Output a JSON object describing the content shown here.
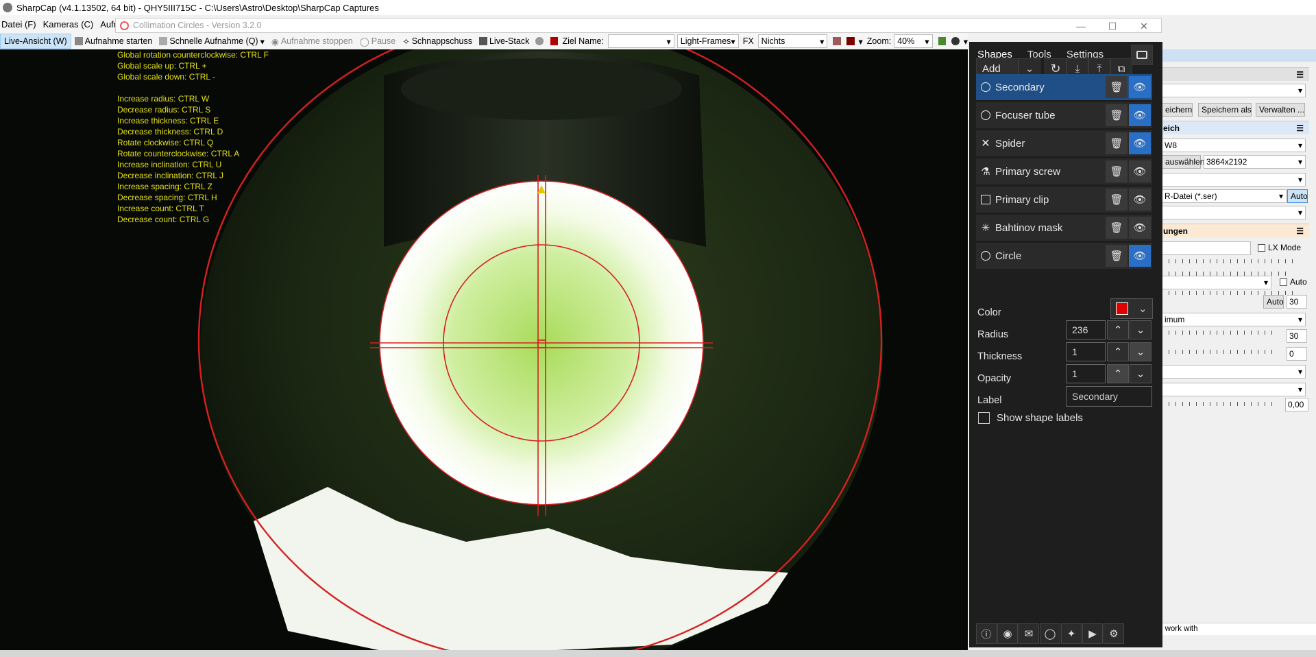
{
  "window": {
    "title": "SharpCap (v4.1.13502, 64 bit) - QHY5III715C - C:\\Users\\Astro\\Desktop\\SharpCap Captures"
  },
  "menu": [
    "Datei (F)",
    "Kameras (C)",
    "Aufna"
  ],
  "popup": {
    "title": "Collimation Circles - Version 3.2.0"
  },
  "toolbar": {
    "live": "Live-Ansicht (W)",
    "start": "Aufnahme starten",
    "quick": "Schnelle Aufnahme (Q)",
    "stop": "Aufnahme stoppen",
    "pause": "Pause",
    "snapshot": "Schnappschuss",
    "livestack": "Live-Stack",
    "target_label": "Ziel Name:",
    "target_value": "",
    "frames": "Light-Frames",
    "fx_label": "FX",
    "fx_value": "Nichts",
    "zoom_label": "Zoom:",
    "zoom_value": "40%"
  },
  "shortcuts": [
    "Global rotation counterclockwise: CTRL F",
    "Global scale up: CTRL +",
    "Global scale down: CTRL -",
    "",
    "Increase radius: CTRL W",
    "Decrease radius: CTRL S",
    "Increase thickness: CTRL E",
    "Decrease thickness: CTRL D",
    "Rotate clockwise: CTRL Q",
    "Rotate counterclockwise: CTRL A",
    "Increase inclination: CTRL U",
    "Decrease inclination: CTRL J",
    "Increase spacing: CTRL Z",
    "Decrease spacing: CTRL H",
    "Increase count: CTRL T",
    "Decrease count: CTRL G"
  ],
  "panel": {
    "tabs": [
      "Shapes",
      "Tools",
      "Settings"
    ],
    "add_label": "Add",
    "shapes": [
      {
        "name": "Secondary",
        "icon": "circle-icon",
        "visible": true
      },
      {
        "name": "Focuser tube",
        "icon": "circle-icon",
        "visible": true
      },
      {
        "name": "Spider",
        "icon": "cross-icon",
        "visible": true
      },
      {
        "name": "Primary screw",
        "icon": "screw-icon",
        "visible": false
      },
      {
        "name": "Primary clip",
        "icon": "square-icon",
        "visible": false
      },
      {
        "name": "Bahtinov mask",
        "icon": "asterisk-icon",
        "visible": false
      },
      {
        "name": "Circle",
        "icon": "circle-icon",
        "visible": true
      }
    ],
    "color_label": "Color",
    "color_value": "#e00000",
    "radius_label": "Radius",
    "radius_value": "236",
    "thickness_label": "Thickness",
    "thickness_value": "1",
    "opacity_label": "Opacity",
    "opacity_value": "1",
    "label_label": "Label",
    "label_value": "Secondary",
    "show_labels": "Show shape labels"
  },
  "right": {
    "speichern": "eichern",
    "speichern_als": "Speichern als",
    "verwalten": "Verwalten ...",
    "bereich": "eich",
    "w8": "W8",
    "auswaehlen": "auswählen",
    "resolution": "3864x2192",
    "format": "R-Datei (*.ser)",
    "auto": "Auto",
    "einst": "ungen",
    "lxmode": "LX Mode",
    "auto2": "Auto",
    "auto3": "Auto",
    "v30": "30",
    "maximum": "imum",
    "v30b": "30",
    "v0": "0",
    "v000": "0,00",
    "status": "o work with"
  }
}
